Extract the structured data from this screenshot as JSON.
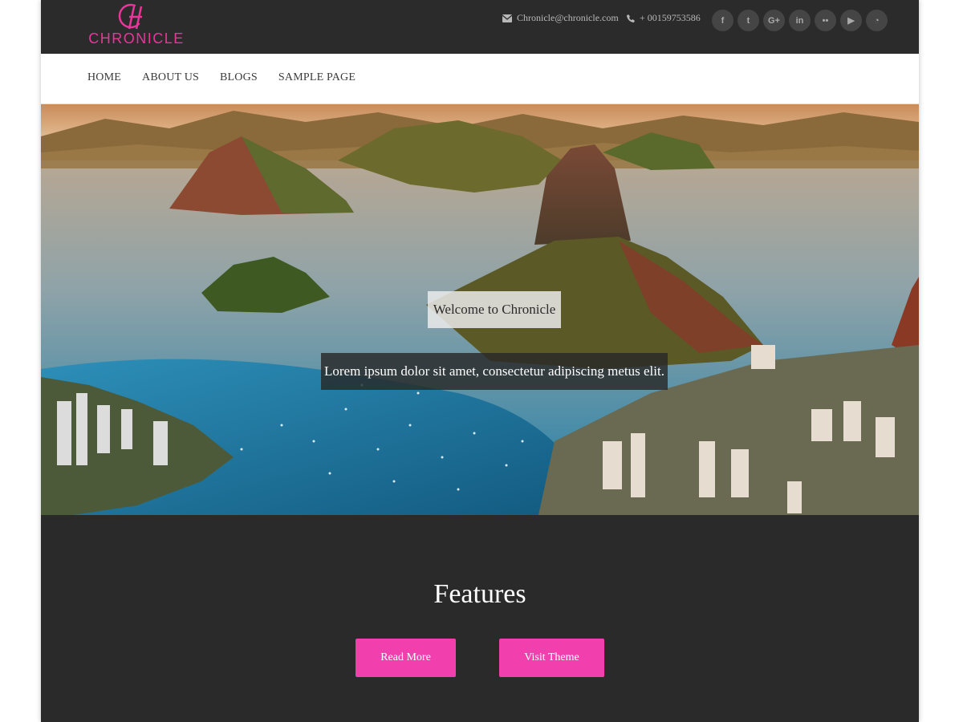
{
  "brand": {
    "name": "CHRONICLE",
    "logo_mark": "CH monogram",
    "accent_color": "#e8369b"
  },
  "contact": {
    "email": "Chronicle@chronicle.com",
    "phone": "+ 00159753586",
    "email_icon": "envelope-icon",
    "phone_icon": "phone-icon"
  },
  "social": [
    {
      "name": "facebook-icon",
      "glyph": "f"
    },
    {
      "name": "twitter-icon",
      "glyph": "t"
    },
    {
      "name": "google-plus-icon",
      "glyph": "G+"
    },
    {
      "name": "linkedin-icon",
      "glyph": "in"
    },
    {
      "name": "flickr-icon",
      "glyph": "••"
    },
    {
      "name": "youtube-icon",
      "glyph": "▶"
    },
    {
      "name": "rss-icon",
      "glyph": "◔"
    }
  ],
  "nav": {
    "items": [
      "HOME",
      "ABOUT US",
      "BLOGS",
      "SAMPLE PAGE"
    ]
  },
  "hero": {
    "welcome": "Welcome to Chronicle",
    "tagline": "Lorem ipsum dolor sit amet, consectetur adipiscing metus elit."
  },
  "features": {
    "title": "Features",
    "read_more": "Read More",
    "visit_theme": "Visit Theme",
    "button_color": "#f23fae"
  }
}
